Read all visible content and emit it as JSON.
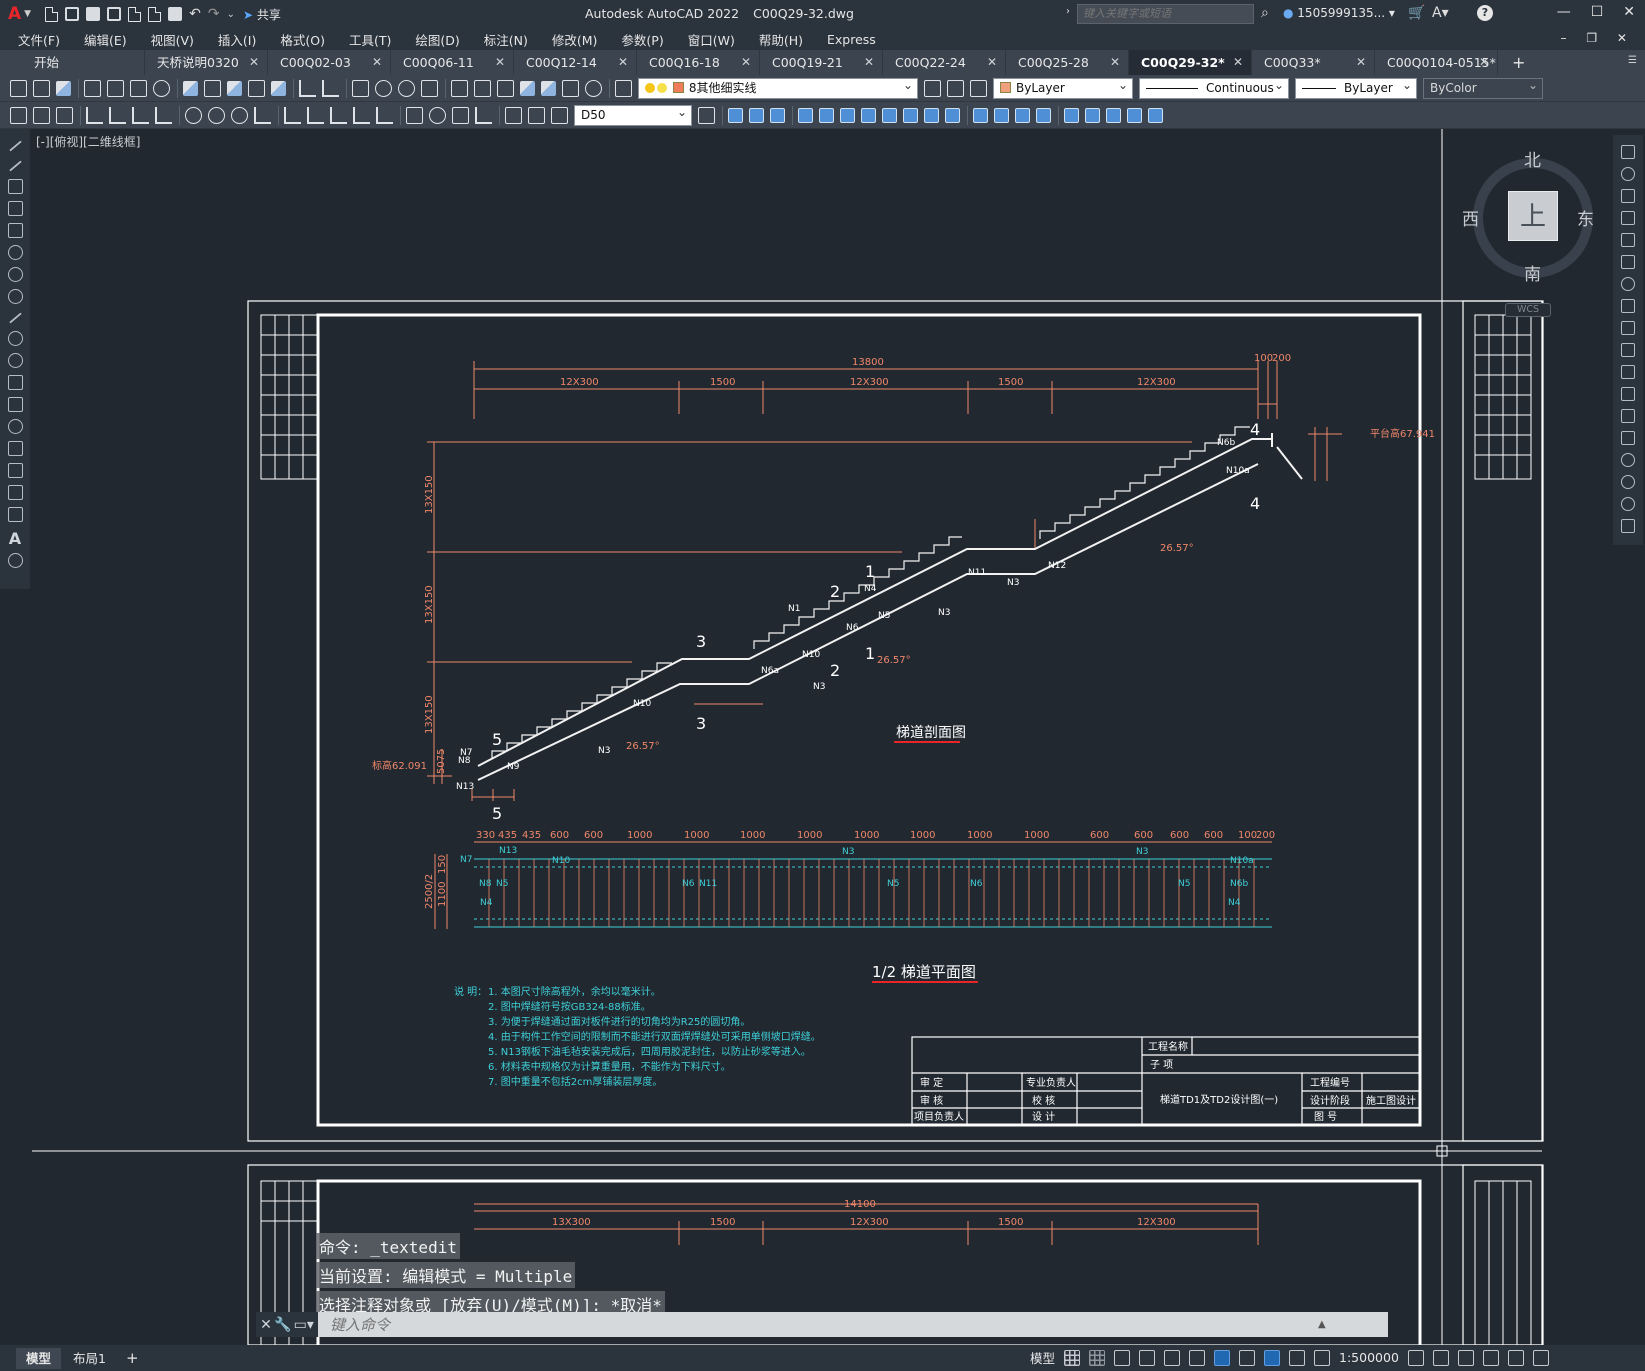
{
  "title_bar": {
    "logo": "A",
    "share_label": "共享",
    "app_name": "Autodesk AutoCAD 2022",
    "file_name": "C00Q29-32.dwg",
    "search_placeholder": "键入关键字或短语",
    "user_name": "1505999135...",
    "help_label": "?"
  },
  "menu": [
    "文件(F)",
    "编辑(E)",
    "视图(V)",
    "插入(I)",
    "格式(O)",
    "工具(T)",
    "绘图(D)",
    "标注(N)",
    "修改(M)",
    "参数(P)",
    "窗口(W)",
    "帮助(H)",
    "Express"
  ],
  "tabs": [
    {
      "label": "开始"
    },
    {
      "label": "天桥说明0320"
    },
    {
      "label": "C00Q02-03"
    },
    {
      "label": "C00Q06-11"
    },
    {
      "label": "C00Q12-14"
    },
    {
      "label": "C00Q16-18"
    },
    {
      "label": "C00Q19-21"
    },
    {
      "label": "C00Q22-24"
    },
    {
      "label": "C00Q25-28"
    },
    {
      "label": "C00Q29-32*"
    },
    {
      "label": "C00Q33*"
    },
    {
      "label": "C00Q0104-0515*"
    }
  ],
  "toolbar": {
    "layer": "8其他细实线",
    "color": "ByLayer",
    "linetype": "Continuous",
    "lineweight": "ByLayer",
    "plotstyle": "ByColor",
    "dimstyle": "D50"
  },
  "viewport": {
    "label": "[-][俯视][二维线框]"
  },
  "viewcube": {
    "north": "北",
    "south": "南",
    "east": "东",
    "west": "西",
    "top": "上",
    "wcs": "WCS"
  },
  "drawing": {
    "dims_top": [
      "13800",
      "12X300",
      "1500",
      "12X300",
      "1500",
      "12X300",
      "100",
      "200"
    ],
    "dims_left": [
      "13X150",
      "13X150",
      "13X150",
      "5075"
    ],
    "section_marks": [
      "1",
      "1",
      "2",
      "2",
      "3",
      "3",
      "4",
      "4",
      "5",
      "5"
    ],
    "bars": [
      "N1",
      "N3",
      "N3",
      "N3",
      "N3",
      "N4",
      "N5",
      "N6",
      "N6a",
      "N6b",
      "N7",
      "N8",
      "N9",
      "N10",
      "N10",
      "N10a",
      "N11",
      "N12",
      "N13"
    ],
    "slope": "26.57°",
    "level_left": "标高62.091",
    "level_right": "平台高67.941",
    "section_title": "梯道剖面图",
    "plan_title": "1/2 梯道平面图",
    "plan_dims": [
      "330",
      "435",
      "435",
      "600",
      "600",
      "1000",
      "1000",
      "1000",
      "1000",
      "1000",
      "1000",
      "1000",
      "1000",
      "600",
      "600",
      "600",
      "600",
      "100",
      "200"
    ],
    "plan_side_dims": [
      "2500/2",
      "150",
      "1100"
    ],
    "bottom_dims": [
      "14100",
      "13X300",
      "1500",
      "12X300",
      "1500",
      "12X300"
    ],
    "notes_label": "说 明：",
    "notes": [
      "1. 本图尺寸除高程外，余均以毫米计。",
      "2. 图中焊缝符号按GB324-88标准。",
      "3. 为便于焊缝通过面对板件进行的切角均为R25的圆切角。",
      "4. 由于构件工作空间的限制而不能进行双面焊焊缝处可采用单侧坡口焊缝。",
      "5. N13钢板下油毛毡安装完成后，四周用胶泥封住，以防止砂浆等进入。",
      "6. 材料表中规格仅为计算重量用，不能作为下料尺寸。",
      "7. 图中重量不包括2cm厚铺装层厚度。"
    ],
    "titleblock": {
      "project_name": "工程名称",
      "subitem": "子 项",
      "approve": "审 定",
      "review": "审 核",
      "pm": "项目负责人",
      "chief": "专业负责人",
      "check": "校 核",
      "design": "设 计",
      "drawing_title": "梯道TD1及TD2设计图(一)",
      "project_no": "工程编号",
      "stage_label": "设计阶段",
      "stage_value": "施工图设计",
      "drawing_no": "图 号"
    }
  },
  "command": {
    "history": [
      "命令: _textedit",
      "当前设置: 编辑模式 = Multiple",
      "选择注释对象或 [放弃(U)/模式(M)]: *取消*"
    ],
    "placeholder": "键入命令"
  },
  "status": {
    "layout_tabs": [
      "模型",
      "布局1"
    ],
    "model_label": "模型",
    "scale": "1:500000"
  }
}
